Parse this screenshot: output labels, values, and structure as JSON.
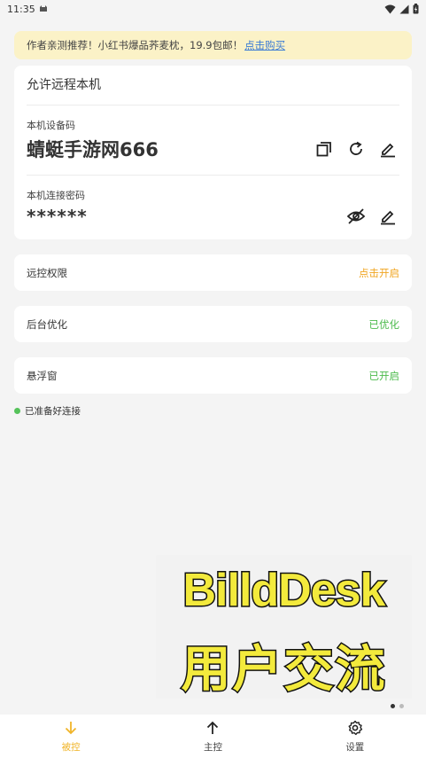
{
  "status_bar": {
    "time": "11:35"
  },
  "promo": {
    "text": "作者亲测推荐！小红书爆品荞麦枕，19.9包邮！",
    "link": "点击购买"
  },
  "remote_card": {
    "title": "允许远程本机",
    "device_code_label": "本机设备码",
    "device_code_value": "蜻蜓手游网666",
    "password_label": "本机连接密码",
    "password_value": "******"
  },
  "rows": {
    "remote_permission": {
      "label": "远控权限",
      "status": "点击开启"
    },
    "background_opt": {
      "label": "后台优化",
      "status": "已优化"
    },
    "floating_window": {
      "label": "悬浮窗",
      "status": "已开启"
    }
  },
  "ready_status": "已准备好连接",
  "banner": {
    "line1": "BilldDesk",
    "line2": "用户交流群"
  },
  "bottom_nav": {
    "controlled": "被控",
    "master": "主控",
    "settings": "设置"
  },
  "colors": {
    "accent": "#f0b428",
    "orange": "#f0a521",
    "green": "#4cbb4c"
  }
}
